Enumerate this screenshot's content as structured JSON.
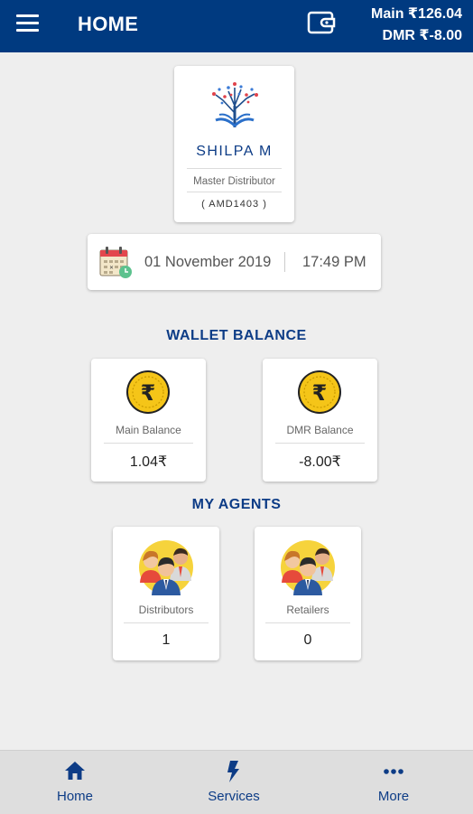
{
  "header": {
    "title": "HOME",
    "main_balance": "Main ₹126.04",
    "dmr_balance": "DMR ₹-8.00",
    "menu_icon": "hamburger-menu-icon",
    "wallet_icon": "wallet-icon"
  },
  "profile": {
    "name": "SHILPA  M",
    "role": "Master Distributor",
    "id": "( AMD1403 )"
  },
  "datetime": {
    "date": "01 November 2019",
    "time": "17:49 PM",
    "icon": "calendar-clock-icon"
  },
  "wallet": {
    "heading": "WALLET BALANCE",
    "cards": [
      {
        "label": "Main Balance",
        "value": "1.04₹"
      },
      {
        "label": "DMR Balance",
        "value": "-8.00₹"
      }
    ]
  },
  "agents": {
    "heading": "MY AGENTS",
    "cards": [
      {
        "label": "Distributors",
        "value": "1"
      },
      {
        "label": "Retailers",
        "value": "0"
      }
    ]
  },
  "nav": {
    "items": [
      {
        "label": "Home",
        "icon": "home-icon"
      },
      {
        "label": "Services",
        "icon": "lightning-icon"
      },
      {
        "label": "More",
        "icon": "more-dots-icon"
      }
    ]
  },
  "colors": {
    "primary": "#003a80",
    "accent_text": "#0d3c86",
    "coin_yellow": "#f5c518",
    "background": "#eeeeee"
  }
}
